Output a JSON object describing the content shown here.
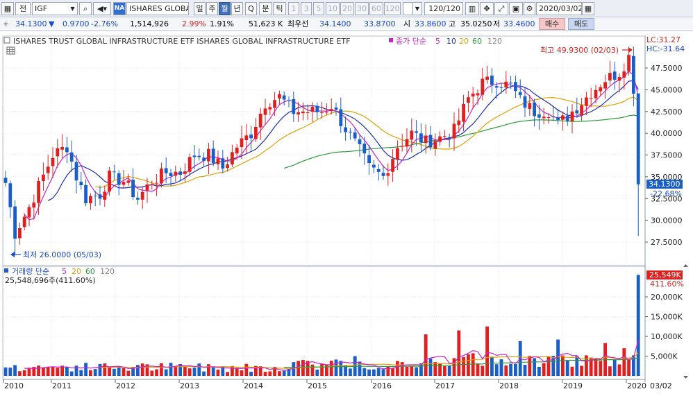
{
  "toolbar": {
    "market_label": "전",
    "symbol": "IGF",
    "na_badge": "NA",
    "name_field": "ISHARES GLOBAL",
    "periods": [
      "일",
      "주",
      "월",
      "년",
      "Q",
      "분",
      "틱"
    ],
    "period_selected": "월",
    "intervals": [
      "1",
      "3",
      "5",
      "10",
      "20",
      "30",
      "60",
      "120"
    ],
    "count": "120/120",
    "date": "2020/03/02"
  },
  "quote": {
    "price": "34.1300",
    "change_arrow": "▼",
    "change": "0.9700",
    "change_pct": "-2.76%",
    "volume": "1,514,926",
    "vol_pct1": "2.99%",
    "vol_pct2": "1.91%",
    "amount": "51,623 K",
    "best_label": "최우선",
    "best_ask": "34.1400",
    "best_bid": "33.8700",
    "open_label": "시",
    "open": "33.8600",
    "high_label": "고",
    "high": "35.0250",
    "low_label": "저",
    "low": "33.4600",
    "buy": "매수",
    "sell": "매도"
  },
  "chart": {
    "title": "ISHARES TRUST GLOBAL INFRASTRUCTURE ETF  ISHARES GLOBAL INFRASTRUCTURE ETF",
    "price_legend": {
      "label": "종가 단순",
      "periods": [
        "5",
        "10",
        "20",
        "60",
        "120"
      ]
    },
    "lc_label": "LC:31.27",
    "hc_label": "HC:-31.64",
    "max_label": "최고 49.9300 (02/03)",
    "min_label": "최저 26.0000 (05/03)",
    "last_price_tag": "34.1300",
    "last_pct_tag": "-22.68%",
    "price_axis": [
      "47.5000",
      "45.0000",
      "42.5000",
      "40.0000",
      "37.5000",
      "35.0000",
      "32.5000",
      "30.0000",
      "27.5000"
    ],
    "volume_legend": {
      "label": "거래량 단순",
      "periods": [
        "5",
        "20",
        "60",
        "120"
      ]
    },
    "volume_info": "25,548,696주(411.60%)",
    "volume_tag": "25,549K",
    "volume_pct_tag": "411.60%",
    "volume_axis": [
      "20,000K",
      "15,000K",
      "10,000K",
      "5,000K"
    ],
    "x_axis": [
      "2010",
      "2011",
      "2012",
      "2013",
      "2014",
      "2015",
      "2016",
      "2017",
      "2018",
      "2019",
      "2020",
      "03/02"
    ]
  },
  "colors": {
    "up": "#e02020",
    "down": "#1a5fc8",
    "ma5": "#cc22cc",
    "ma10": "#1a2fb0",
    "ma20": "#e0a000",
    "ma60": "#2a9a3a",
    "ma120": "#888888",
    "grid": "#d9dde6"
  }
}
